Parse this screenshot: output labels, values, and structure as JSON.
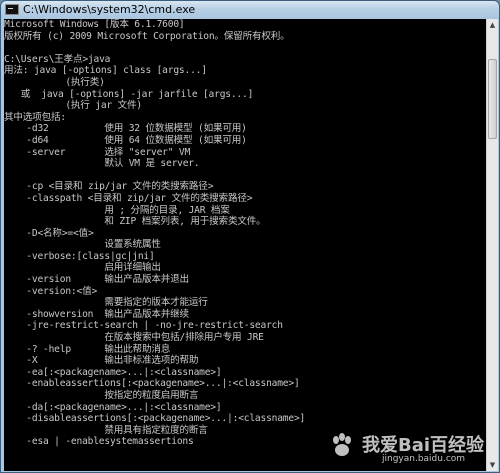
{
  "window": {
    "title": "C:\\Windows\\system32\\cmd.exe"
  },
  "console": {
    "lines": [
      "Microsoft Windows [版本 6.1.7600]",
      "版权所有 (c) 2009 Microsoft Corporation。保留所有权利。",
      "",
      "C:\\Users\\王孝点>java",
      "用法: java [-options] class [args...]",
      "           (执行类)",
      "   或  java [-options] -jar jarfile [args...]",
      "           (执行 jar 文件)",
      "其中选项包括:",
      "    -d32          使用 32 位数据模型 (如果可用)",
      "    -d64          使用 64 位数据模型 (如果可用)",
      "    -server       选择 \"server\" VM",
      "                  默认 VM 是 server.",
      "",
      "    -cp <目录和 zip/jar 文件的类搜索路径>",
      "    -classpath <目录和 zip/jar 文件的类搜索路径>",
      "                  用 ; 分隔的目录, JAR 档案",
      "                  和 ZIP 档案列表, 用于搜索类文件。",
      "    -D<名称>=<值>",
      "                  设置系统属性",
      "    -verbose:[class|gc|jni]",
      "                  启用详细输出",
      "    -version      输出产品版本并退出",
      "    -version:<值>",
      "                  需要指定的版本才能运行",
      "    -showversion  输出产品版本并继续",
      "    -jre-restrict-search | -no-jre-restrict-search",
      "                  在版本搜索中包括/排除用户专用 JRE",
      "    -? -help      输出此帮助消息",
      "    -X            输出非标准选项的帮助",
      "    -ea[:<packagename>...|:<classname>]",
      "    -enableassertions[:<packagename>...|:<classname>]",
      "                  按指定的粒度启用断言",
      "    -da[:<packagename>...|:<classname>]",
      "    -disableassertions[:<packagename>...|:<classname>]",
      "                  禁用具有指定粒度的断言",
      "    -esa | -enablesystemassertions"
    ]
  },
  "watermark": {
    "main": "我爱Bai百经验",
    "url": "jingyan.baidu.com"
  },
  "colors": {
    "console_bg": "#000000",
    "console_text": "#c8c8c8",
    "titlebar": "#a9c6e0"
  }
}
